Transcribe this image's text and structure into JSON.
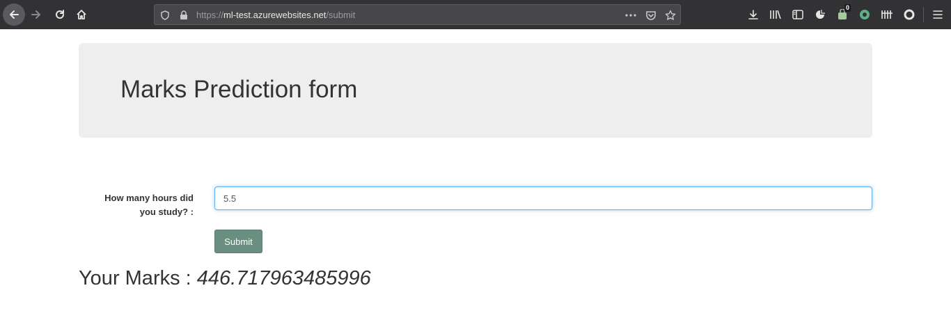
{
  "browser": {
    "url_scheme": "https://",
    "url_host": "ml-test.azurewebsites.net",
    "url_path": "/submit",
    "notification_badge": "0",
    "icons": {
      "back": "back-arrow-icon",
      "forward": "forward-arrow-icon",
      "reload": "reload-icon",
      "home": "home-icon",
      "tracking": "shield-icon",
      "lock": "lock-icon",
      "page_actions": "more-dots-icon",
      "pocket": "pocket-icon",
      "bookmark": "star-icon",
      "download": "download-icon",
      "library": "library-icon",
      "sidebar": "sidebar-icon",
      "extension1": "pie-extension-icon",
      "extension2": "bag-extension-icon",
      "extension3": "circle-extension-icon",
      "extension4": "bars-extension-icon",
      "extension5": "ring-extension-icon",
      "menu": "hamburger-menu-icon"
    }
  },
  "page": {
    "title": "Marks Prediction form",
    "form": {
      "label_line1": "How many hours did",
      "label_line2": "you study? :",
      "hours_value": "5.5",
      "submit_label": "Submit"
    },
    "result": {
      "prefix": "Your Marks : ",
      "value": "446.717963485996"
    }
  },
  "colors": {
    "toolbar_bg": "#323234",
    "jumbotron_bg": "#eeeeee",
    "submit_bg": "#6a8e7f",
    "input_focus_border": "#66afe9",
    "text": "#333333"
  }
}
